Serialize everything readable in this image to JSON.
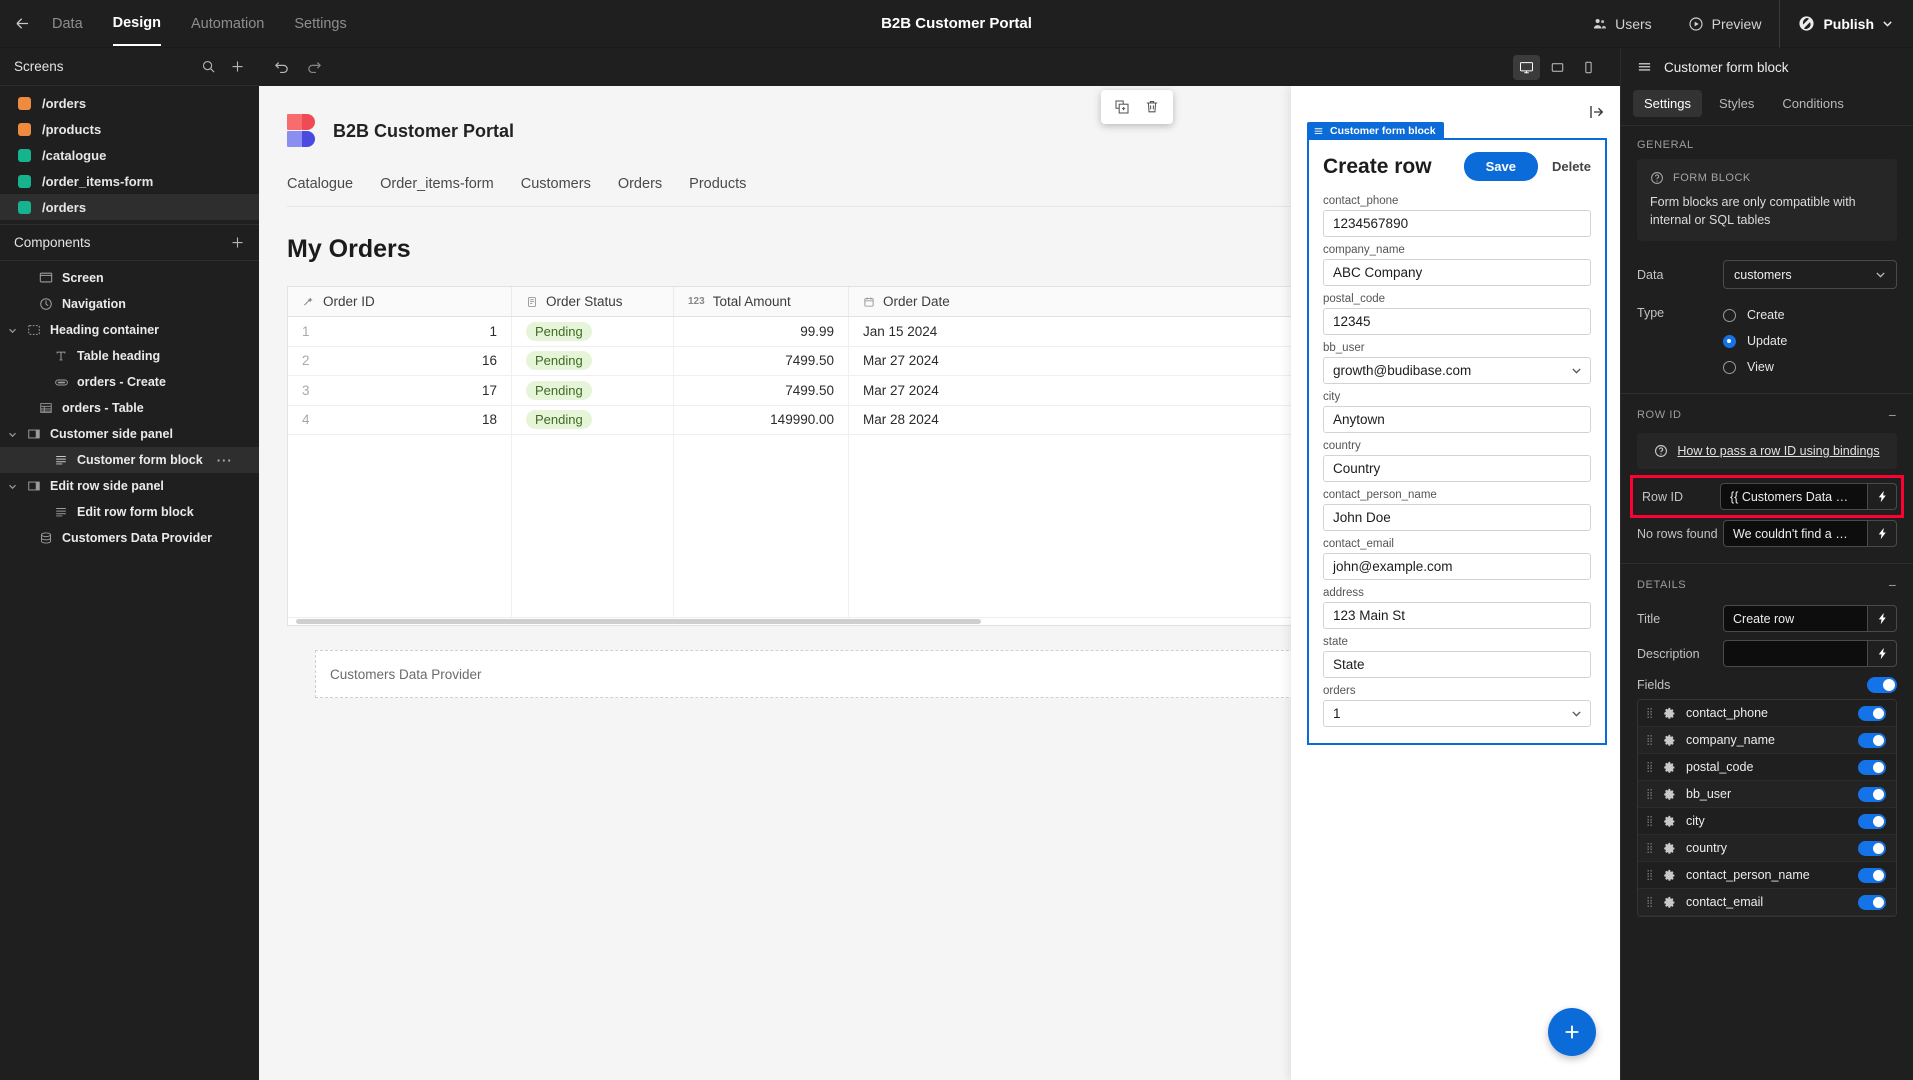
{
  "topbar": {
    "back_icon": "arrow-left-icon",
    "nav": [
      {
        "label": "Data",
        "active": false
      },
      {
        "label": "Design",
        "active": true
      },
      {
        "label": "Automation",
        "active": false
      },
      {
        "label": "Settings",
        "active": false
      }
    ],
    "app_title": "B2B Customer Portal",
    "users_label": "Users",
    "preview_label": "Preview",
    "publish_label": "Publish"
  },
  "screens_panel": {
    "title": "Screens",
    "search_icon": "search-icon",
    "add_icon": "plus-icon",
    "items": [
      {
        "label": "/orders",
        "color": "#ef8b3f",
        "selected": false
      },
      {
        "label": "/products",
        "color": "#ef8b3f",
        "selected": false
      },
      {
        "label": "/catalogue",
        "color": "#16b48e",
        "selected": false
      },
      {
        "label": "/order_items-form",
        "color": "#16b48e",
        "selected": false
      },
      {
        "label": "/orders",
        "color": "#16b48e",
        "selected": true
      }
    ]
  },
  "components_panel": {
    "title": "Components",
    "add_icon": "plus-icon",
    "items": [
      {
        "label": "Screen",
        "icon": "screen-icon",
        "indent": 0,
        "caret": "",
        "selected": false,
        "menu": false
      },
      {
        "label": "Navigation",
        "icon": "navigation-icon",
        "indent": 0,
        "caret": "",
        "selected": false,
        "menu": false
      },
      {
        "label": "Heading container",
        "icon": "container-icon",
        "indent": 0,
        "caret": "down",
        "selected": false,
        "menu": false
      },
      {
        "label": "Table heading",
        "icon": "text-icon",
        "indent": 1,
        "caret": "",
        "selected": false,
        "menu": false
      },
      {
        "label": "orders - Create",
        "icon": "button-icon",
        "indent": 1,
        "caret": "",
        "selected": false,
        "menu": false
      },
      {
        "label": "orders - Table",
        "icon": "table-icon",
        "indent": 0,
        "caret": "",
        "selected": false,
        "menu": false
      },
      {
        "label": "Customer side panel",
        "icon": "sidepanel-icon",
        "indent": 0,
        "caret": "down",
        "selected": false,
        "menu": false
      },
      {
        "label": "Customer form block",
        "icon": "formblock-icon",
        "indent": 1,
        "caret": "",
        "selected": true,
        "menu": true
      },
      {
        "label": "Edit row side panel",
        "icon": "sidepanel-icon",
        "indent": 0,
        "caret": "down",
        "selected": false,
        "menu": false
      },
      {
        "label": "Edit row form block",
        "icon": "formblock-icon",
        "indent": 1,
        "caret": "",
        "selected": false,
        "menu": false
      },
      {
        "label": "Customers Data Provider",
        "icon": "dataprovider-icon",
        "indent": 0,
        "caret": "",
        "selected": false,
        "menu": false
      }
    ],
    "menu_dots": "···"
  },
  "canvas_bar": {
    "undo_icon": "undo-icon",
    "redo_icon": "redo-icon",
    "devices": [
      {
        "name": "desktop-icon",
        "active": true
      },
      {
        "name": "tablet-icon",
        "active": false
      },
      {
        "name": "mobile-icon",
        "active": false
      }
    ]
  },
  "float_toolbar": {
    "duplicate_icon": "duplicate-icon",
    "delete_icon": "trash-icon"
  },
  "preview": {
    "app_name": "B2B Customer Portal",
    "nav_links": [
      "Catalogue",
      "Order_items-form",
      "Customers",
      "Orders",
      "Products"
    ],
    "heading": "My Orders",
    "table": {
      "columns": [
        {
          "label": "Order ID",
          "icon": "formula-icon"
        },
        {
          "label": "Order Status",
          "icon": "options-icon"
        },
        {
          "label": "Total Amount",
          "icon": "number-icon"
        },
        {
          "label": "Order Date",
          "icon": "date-icon"
        }
      ],
      "rows": [
        {
          "num": "1",
          "order_id": "1",
          "status": "Pending",
          "total": "99.99",
          "date": "Jan 15 2024"
        },
        {
          "num": "2",
          "order_id": "16",
          "status": "Pending",
          "total": "7499.50",
          "date": "Mar 27 2024"
        },
        {
          "num": "3",
          "order_id": "17",
          "status": "Pending",
          "total": "7499.50",
          "date": "Mar 27 2024"
        },
        {
          "num": "4",
          "order_id": "18",
          "status": "Pending",
          "total": "149990.00",
          "date": "Mar 28 2024"
        }
      ]
    },
    "data_provider_label": "Customers Data Provider",
    "fab_icon": "plus-icon"
  },
  "side_panel": {
    "collapse_icon": "collapse-right-icon",
    "block_tag": "Customer form block",
    "block_tag_icon": "formblock-icon",
    "form_title": "Create row",
    "save_label": "Save",
    "delete_label": "Delete",
    "fields": [
      {
        "label": "contact_phone",
        "value": "1234567890",
        "type": "text"
      },
      {
        "label": "company_name",
        "value": "ABC Company",
        "type": "text"
      },
      {
        "label": "postal_code",
        "value": "12345",
        "type": "text"
      },
      {
        "label": "bb_user",
        "value": "growth@budibase.com",
        "type": "select"
      },
      {
        "label": "city",
        "value": "Anytown",
        "type": "text"
      },
      {
        "label": "country",
        "value": "Country",
        "type": "text"
      },
      {
        "label": "contact_person_name",
        "value": "John Doe",
        "type": "text"
      },
      {
        "label": "contact_email",
        "value": "john@example.com",
        "type": "text"
      },
      {
        "label": "address",
        "value": "123 Main St",
        "type": "text"
      },
      {
        "label": "state",
        "value": "State",
        "type": "text"
      },
      {
        "label": "orders",
        "value": "1",
        "type": "select"
      }
    ]
  },
  "settings_panel": {
    "header_icon": "formblock-icon",
    "header_title": "Customer form block",
    "tabs": [
      {
        "label": "Settings",
        "active": true
      },
      {
        "label": "Styles",
        "active": false
      },
      {
        "label": "Conditions",
        "active": false
      }
    ],
    "general": {
      "section_label": "GENERAL",
      "info_icon": "question-circle-icon",
      "info_title": "FORM BLOCK",
      "info_text": "Form blocks are only compatible with internal or SQL tables",
      "data_label": "Data",
      "data_value": "customers",
      "type_label": "Type",
      "type_options": [
        {
          "label": "Create",
          "selected": false
        },
        {
          "label": "Update",
          "selected": true
        },
        {
          "label": "View",
          "selected": false
        }
      ]
    },
    "row_id": {
      "section_label": "ROW ID",
      "collapse_icon": "minus-icon",
      "help_icon": "question-circle-icon",
      "help_link": "How to pass a row ID using bindings",
      "row_id_label": "Row ID",
      "row_id_value": "{{ Customers Data …",
      "no_rows_label": "No rows found",
      "no_rows_value": "We couldn't find a …",
      "binding_icon": "lightning-icon"
    },
    "details": {
      "section_label": "DETAILS",
      "collapse_icon": "minus-icon",
      "title_label": "Title",
      "title_value": "Create row",
      "description_label": "Description",
      "description_value": "",
      "fields_label": "Fields",
      "fields_toggle": true,
      "field_items": [
        {
          "name": "contact_phone",
          "enabled": true
        },
        {
          "name": "company_name",
          "enabled": true
        },
        {
          "name": "postal_code",
          "enabled": true
        },
        {
          "name": "bb_user",
          "enabled": true
        },
        {
          "name": "city",
          "enabled": true
        },
        {
          "name": "country",
          "enabled": true
        },
        {
          "name": "contact_person_name",
          "enabled": true
        },
        {
          "name": "contact_email",
          "enabled": true
        }
      ]
    },
    "highlight_color": "#ff0033"
  }
}
